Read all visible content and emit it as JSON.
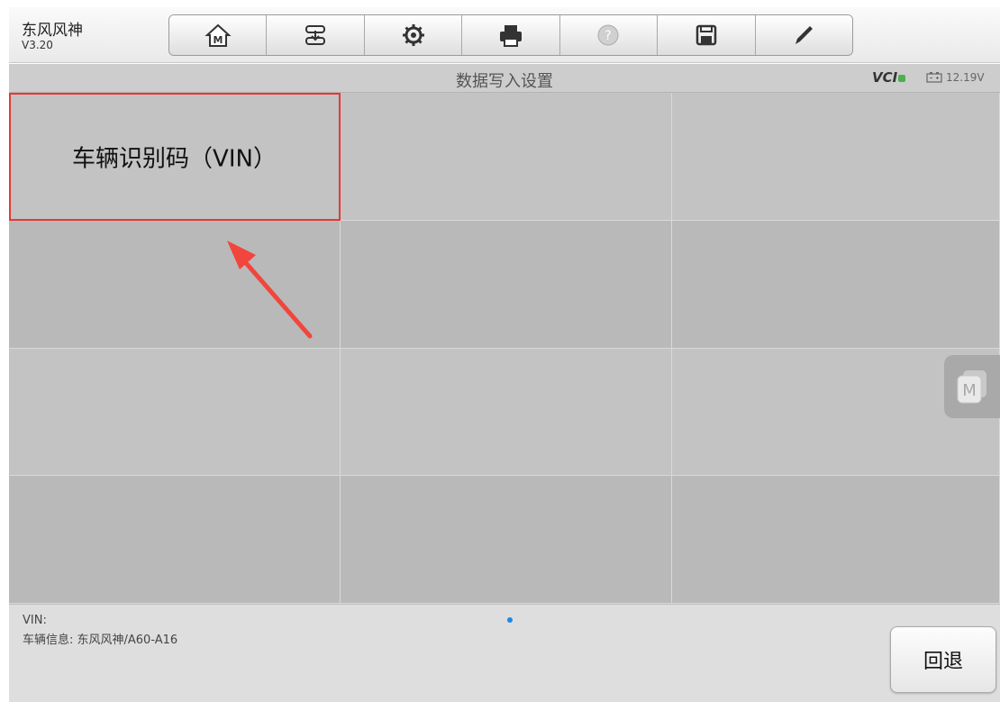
{
  "app": {
    "name": "东风风神",
    "version": "V3.20"
  },
  "toolbar": {
    "buttons": [
      {
        "icon": "home-icon"
      },
      {
        "icon": "vehicle-swap-icon"
      },
      {
        "icon": "settings-gear-icon"
      },
      {
        "icon": "printer-icon"
      },
      {
        "icon": "help-icon"
      },
      {
        "icon": "save-icon"
      },
      {
        "icon": "pen-icon"
      }
    ]
  },
  "titlebar": {
    "title": "数据写入设置",
    "vci": "VCI",
    "voltage": "12.19V"
  },
  "grid": {
    "items": [
      {
        "label": "车辆识别码（VIN）"
      },
      {
        "label": ""
      },
      {
        "label": ""
      },
      {
        "label": ""
      },
      {
        "label": ""
      },
      {
        "label": ""
      },
      {
        "label": ""
      },
      {
        "label": ""
      },
      {
        "label": ""
      },
      {
        "label": ""
      },
      {
        "label": ""
      },
      {
        "label": ""
      }
    ]
  },
  "footer": {
    "vin": "VIN:",
    "vehicle_info": "车辆信息: 东风风神/A60-A16",
    "back_label": "回退"
  },
  "colors": {
    "highlight": "#e53935",
    "page_dot": "#1e88e5",
    "vci_ok": "#4caf50"
  }
}
